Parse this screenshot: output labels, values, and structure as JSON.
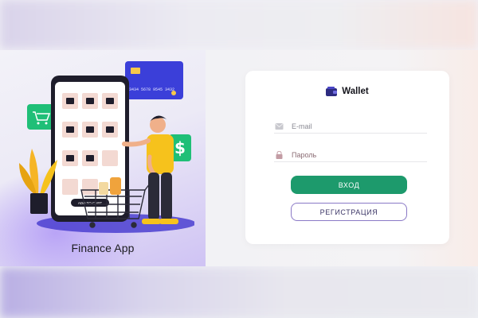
{
  "hero": {
    "caption": "Finance App",
    "card_number": "3434 5678 9545 3432",
    "phone_button": "ADD TO CART"
  },
  "login": {
    "brand": "Wallet",
    "email_placeholder": "E-mail",
    "password_placeholder": "Пароль",
    "login_button": "ВХОД",
    "register_button": "РЕГИСТРАЦИЯ"
  },
  "colors": {
    "primary_green": "#1d9a6c",
    "register_border": "#8a79c6",
    "card_blue": "#3b3fd9",
    "figure_yellow": "#f6c21c"
  },
  "icons": [
    "wallet-icon",
    "mail-icon",
    "lock-icon",
    "shopping-cart-icon",
    "dollar-icon",
    "credit-card-icon"
  ]
}
